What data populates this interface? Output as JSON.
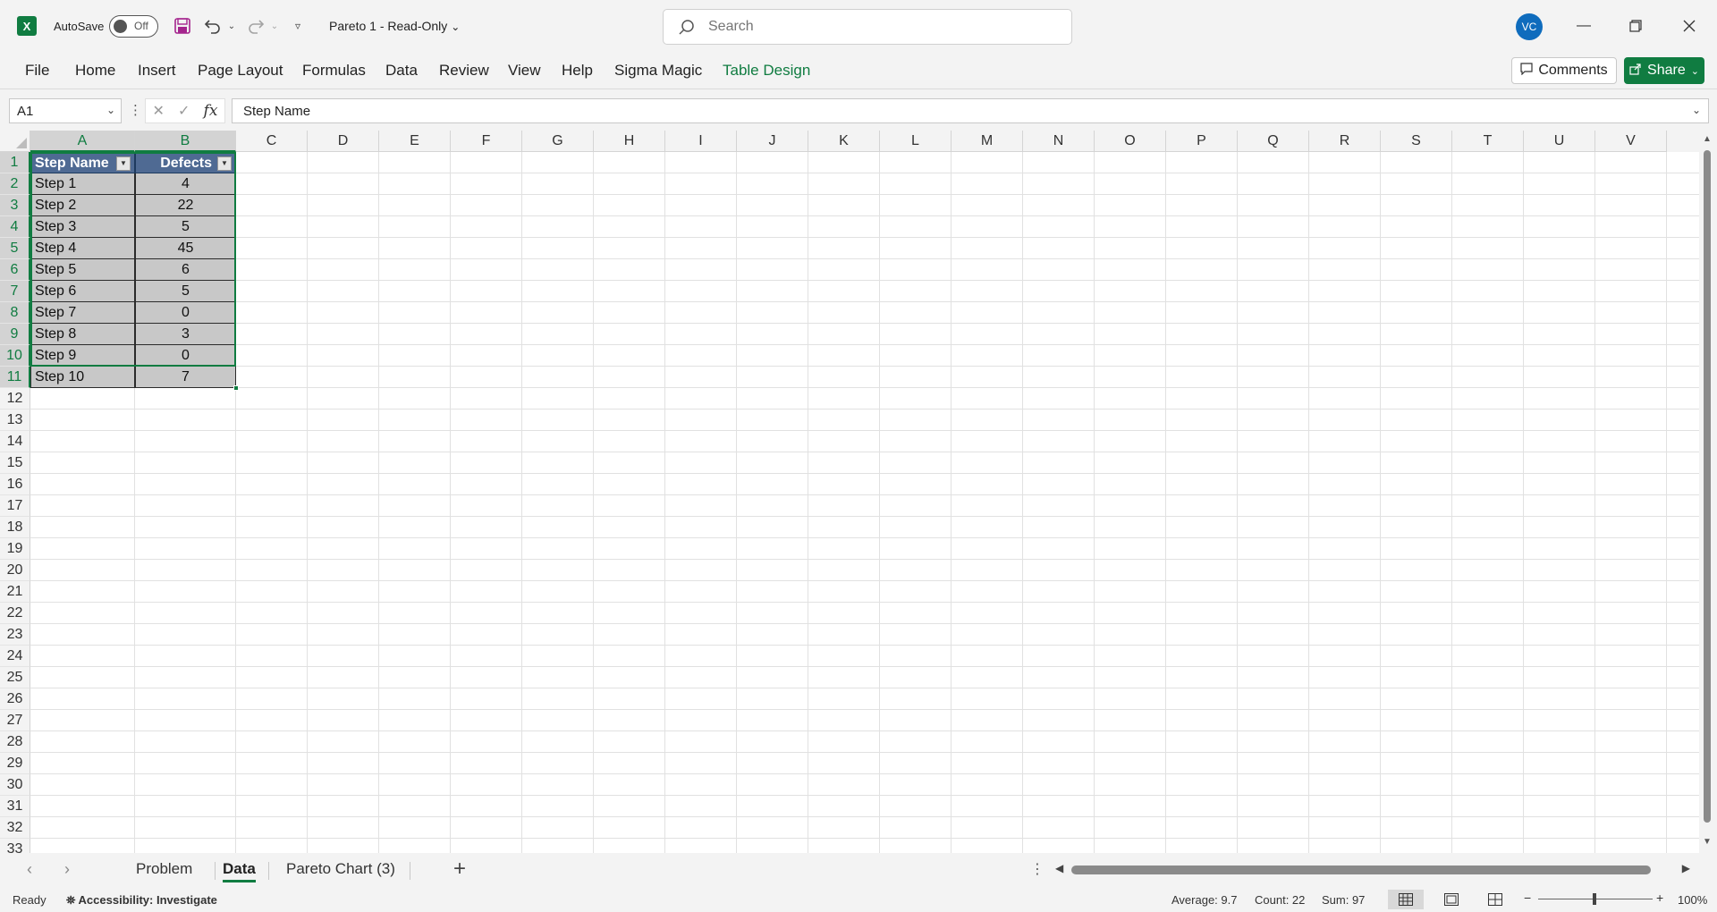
{
  "titlebar": {
    "app_icon": "excel-icon",
    "autosave_label": "AutoSave",
    "autosave_state": "Off",
    "doc_title": "Pareto 1  -  Read-Only",
    "search_placeholder": "Search",
    "avatar_initials": "VC"
  },
  "ribbon": {
    "tabs": [
      "File",
      "Home",
      "Insert",
      "Page Layout",
      "Formulas",
      "Data",
      "Review",
      "View",
      "Help",
      "Sigma Magic",
      "Table Design"
    ],
    "comments_label": "Comments",
    "share_label": "Share",
    "accent_color": "#107c41"
  },
  "formula_bar": {
    "name_box": "A1",
    "formula": "Step Name",
    "fx_label": "fx"
  },
  "grid": {
    "columns": [
      "A",
      "B",
      "C",
      "D",
      "E",
      "F",
      "G",
      "H",
      "I",
      "J",
      "K",
      "L",
      "M",
      "N",
      "O",
      "P",
      "Q",
      "R",
      "S",
      "T",
      "U",
      "V"
    ],
    "rows": [
      "1",
      "2",
      "3",
      "4",
      "5",
      "6",
      "7",
      "8",
      "9",
      "10",
      "11",
      "12",
      "13",
      "14",
      "15",
      "16",
      "17",
      "18",
      "19",
      "20",
      "21",
      "22",
      "23",
      "24",
      "25",
      "26",
      "27",
      "28",
      "29",
      "30",
      "31",
      "32",
      "33"
    ],
    "table": {
      "headers": [
        "Step Name",
        "Defects"
      ],
      "rows": [
        [
          "Step 1",
          "4"
        ],
        [
          "Step 2",
          "22"
        ],
        [
          "Step 3",
          "5"
        ],
        [
          "Step 4",
          "45"
        ],
        [
          "Step 5",
          "6"
        ],
        [
          "Step 6",
          "5"
        ],
        [
          "Step 7",
          "0"
        ],
        [
          "Step 8",
          "3"
        ],
        [
          "Step 9",
          "0"
        ],
        [
          "Step 10",
          "7"
        ]
      ],
      "header_color": "#4f6a93",
      "body_color": "#c8c8c8"
    }
  },
  "sheets": {
    "tabs": [
      "Problem",
      "Data",
      "Pareto Chart (3)"
    ],
    "active": "Data"
  },
  "statusbar": {
    "ready": "Ready",
    "accessibility": "Accessibility: Investigate",
    "average": "Average: 9.7",
    "count": "Count: 22",
    "sum": "Sum: 97",
    "zoom": "100%"
  }
}
